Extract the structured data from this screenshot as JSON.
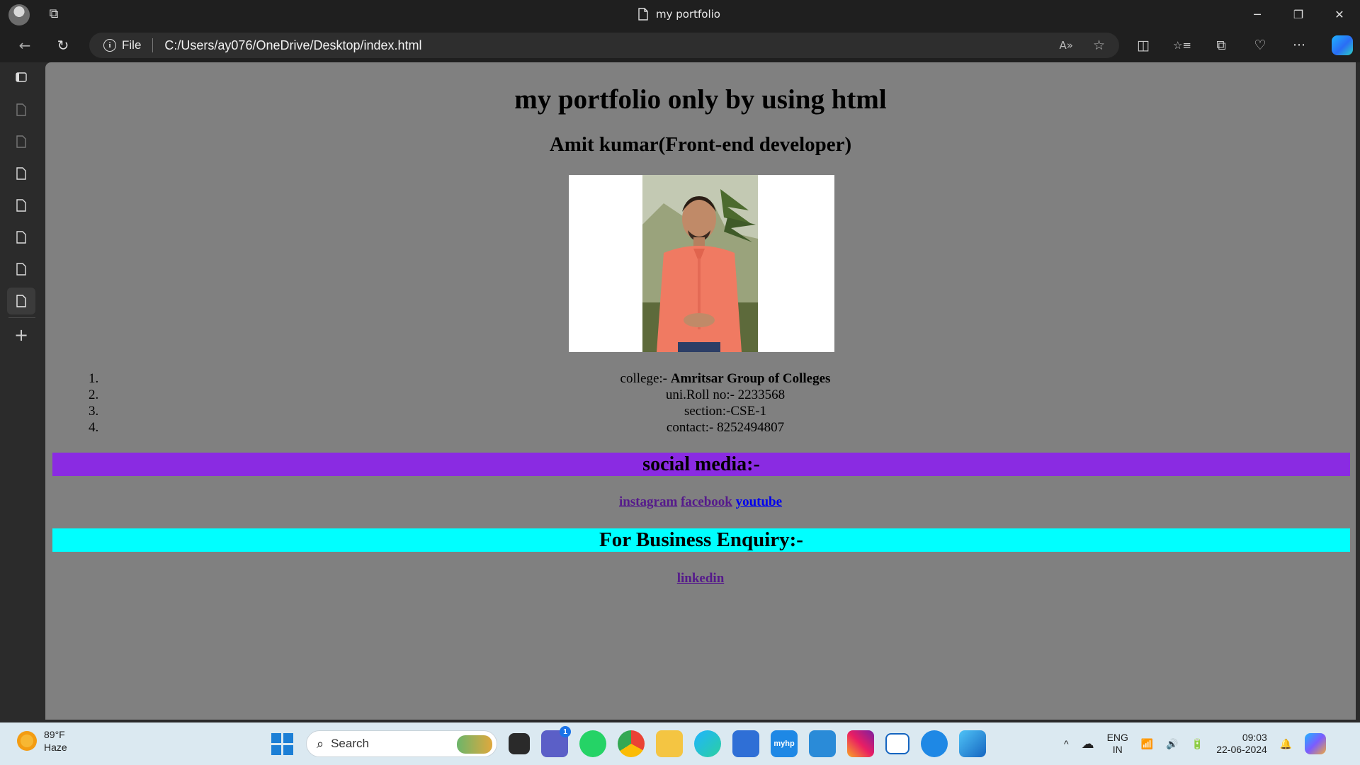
{
  "window": {
    "title": "my portfolio",
    "controls": {
      "minimize": "─",
      "restore": "❐",
      "close": "✕"
    }
  },
  "toolbar": {
    "back_icon": "←",
    "refresh_icon": "↻",
    "site_label": "File",
    "url": "C:/Users/ay076/OneDrive/Desktop/index.html",
    "read_aloud_icon": "A»",
    "favorite_icon": "☆",
    "split_icon": "◫",
    "favorites_icon": "☆≡",
    "collections_icon": "⧉",
    "performance_icon": "♡",
    "more_icon": "···"
  },
  "sidebar": {
    "items": [
      "tab-actions",
      "tab-1",
      "tab-2",
      "tab-3",
      "tab-4",
      "tab-5",
      "tab-6",
      "tab-7"
    ],
    "new_tab_icon": "+"
  },
  "page": {
    "heading": "my portfolio only by using html",
    "subheading": "Amit kumar(Front-end developer)",
    "photo_alt": "profile photo",
    "info": [
      {
        "label": "college:- ",
        "value": "Amritsar Group of Colleges"
      },
      {
        "label": "uni.Roll no:- 2233568"
      },
      {
        "label": "section:-CSE-1"
      },
      {
        "label": "contact:- 8252494807"
      }
    ],
    "social_heading": "social media:-",
    "social_links": [
      "instagram",
      "facebook",
      "youtube"
    ],
    "business_heading": "For Business Enquiry:-",
    "business_links": [
      "linkedin"
    ],
    "colors": {
      "background": "#808080",
      "social_bar": "#8a2be2",
      "business_bar": "#00ffff",
      "visited_link": "#551a8b",
      "link": "#0000ee"
    }
  },
  "taskbar": {
    "weather": {
      "temp": "89°F",
      "condition": "Haze"
    },
    "search_placeholder": "Search",
    "chat_badge": "1",
    "tray": {
      "lang_top": "ENG",
      "lang_bottom": "IN",
      "time": "09:03",
      "date": "22-06-2024",
      "chevron": "^"
    }
  }
}
